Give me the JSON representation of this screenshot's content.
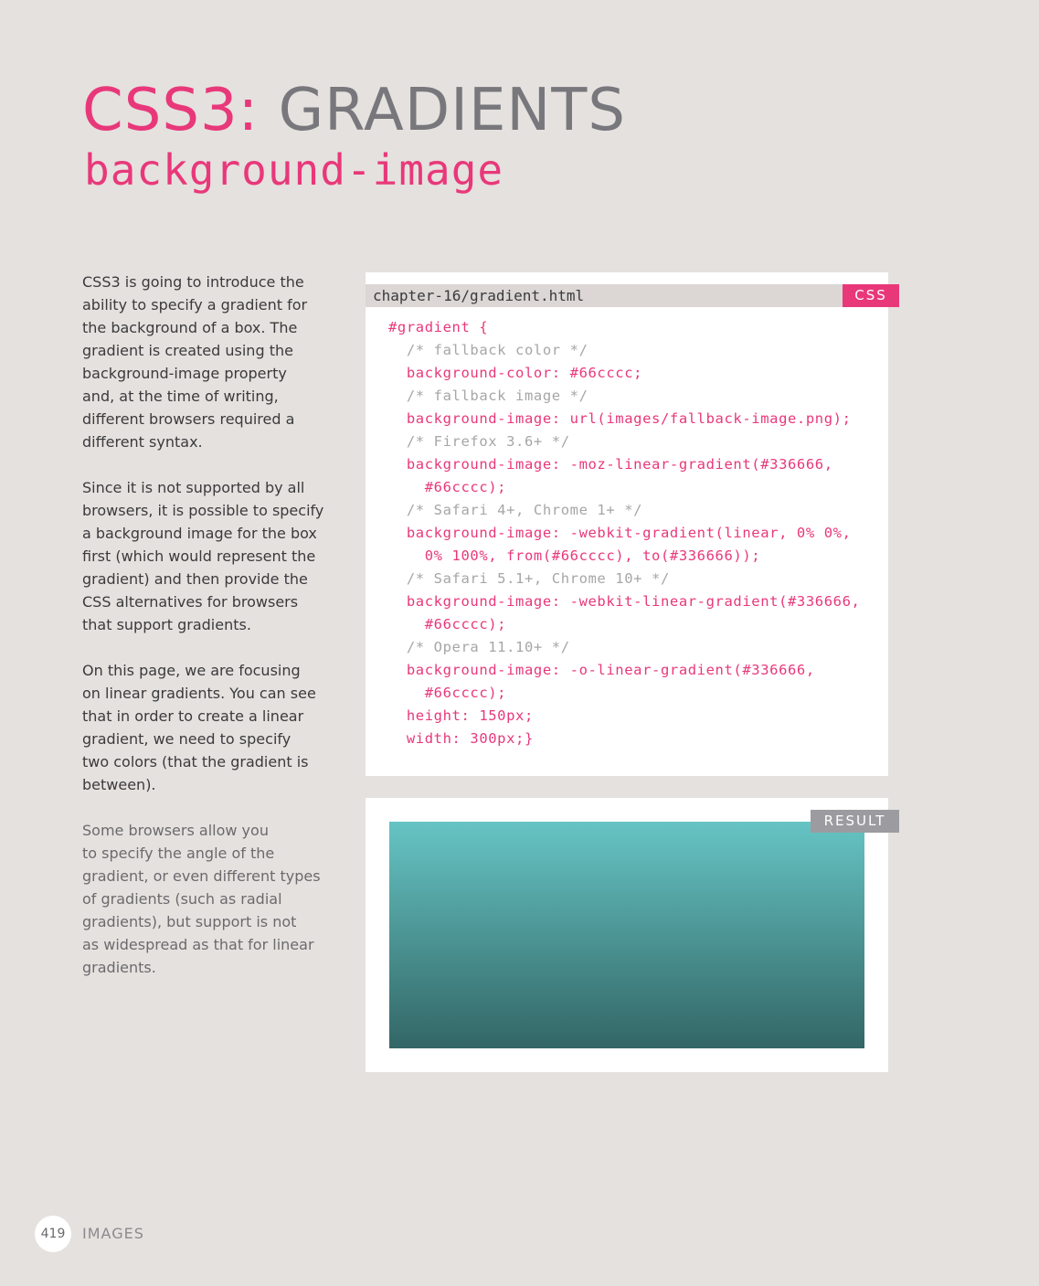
{
  "title": {
    "prefix": "CSS3:",
    "main": "GRADIENTS"
  },
  "subtitle": "background-image",
  "paragraphs": [
    "CSS3 is going to introduce the\nability to specify a gradient for\nthe background of a box. The\ngradient is created using the\nbackground-image property\nand, at the time of writing,\ndifferent browsers required a\ndifferent syntax.",
    "Since it is not supported by all\nbrowsers, it is possible to specify\na background image for the box\nfirst (which would represent the\ngradient) and then provide the\nCSS alternatives for browsers\nthat support gradients.",
    "On this page, we are focusing\non linear gradients. You can see\nthat in order to create a linear\ngradient, we need to specify\ntwo colors (that the gradient is\nbetween).",
    "Some browsers allow you\nto specify the angle of the\ngradient, or even different types\nof gradients (such as radial\ngradients), but support is not\nas widespread as that for linear\ngradients."
  ],
  "code_panel": {
    "filename": "chapter-16/gradient.html",
    "badge": "CSS",
    "lines": [
      {
        "text": "#gradient {",
        "kind": "code"
      },
      {
        "text": "  /* fallback color */",
        "kind": "comment"
      },
      {
        "text": "  background-color: #66cccc;",
        "kind": "code"
      },
      {
        "text": "  /* fallback image */",
        "kind": "comment"
      },
      {
        "text": "  background-image: url(images/fallback-image.png);",
        "kind": "code"
      },
      {
        "text": "  /* Firefox 3.6+ */",
        "kind": "comment"
      },
      {
        "text": "  background-image: -moz-linear-gradient(#336666,",
        "kind": "code"
      },
      {
        "text": "    #66cccc);",
        "kind": "code"
      },
      {
        "text": "  /* Safari 4+, Chrome 1+ */",
        "kind": "comment"
      },
      {
        "text": "  background-image: -webkit-gradient(linear, 0% 0%,",
        "kind": "code"
      },
      {
        "text": "    0% 100%, from(#66cccc), to(#336666));",
        "kind": "code"
      },
      {
        "text": "  /* Safari 5.1+, Chrome 10+ */",
        "kind": "comment"
      },
      {
        "text": "  background-image: -webkit-linear-gradient(#336666,",
        "kind": "code"
      },
      {
        "text": "    #66cccc);",
        "kind": "code"
      },
      {
        "text": "  /* Opera 11.10+ */",
        "kind": "comment"
      },
      {
        "text": "  background-image: -o-linear-gradient(#336666,",
        "kind": "code"
      },
      {
        "text": "    #66cccc);",
        "kind": "code"
      },
      {
        "text": "  height: 150px;",
        "kind": "code"
      },
      {
        "text": "  width: 300px;}",
        "kind": "code"
      }
    ]
  },
  "result_panel": {
    "badge": "RESULT",
    "gradient_top_color": "#66c4c4",
    "gradient_bottom_color": "#336666"
  },
  "footer": {
    "page_number": "419",
    "section": "IMAGES"
  },
  "colors": {
    "accent_pink": "#e8387a",
    "title_gray": "#77777c",
    "page_background": "#e5e1de",
    "comment_gray": "#a6a6a8"
  }
}
